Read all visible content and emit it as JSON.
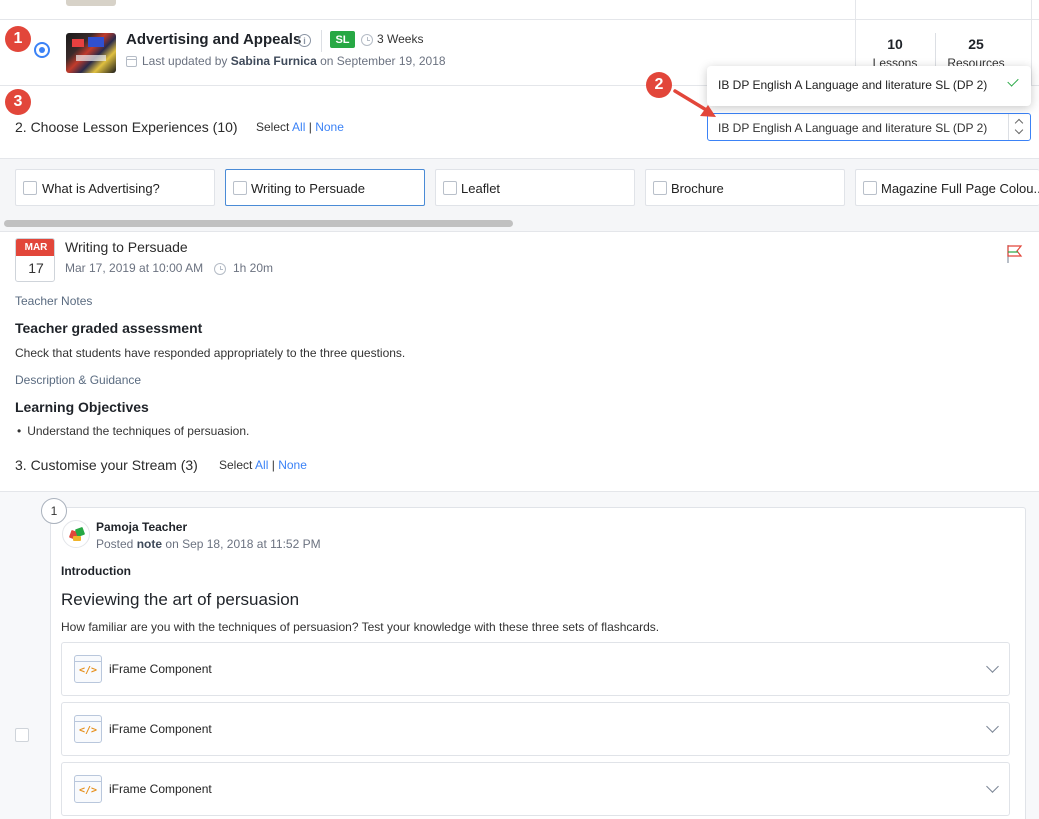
{
  "annotations": {
    "one": "1",
    "two": "2",
    "three": "3"
  },
  "unit": {
    "title": "Advertising and Appeals",
    "level_badge": "SL",
    "duration": "3 Weeks",
    "updated_prefix": "Last updated by",
    "updated_by": "Sabina Furnica",
    "updated_on": "on September 19, 2018",
    "lessons_count": "10",
    "lessons_label": "Lessons",
    "resources_count": "25",
    "resources_label": "Resources"
  },
  "lesson_experiences": {
    "title": "2. Choose Lesson Experiences (10)",
    "select_label": "Select",
    "all_label": "All",
    "separator": "|",
    "none_label": "None",
    "course_select_value": "IB DP English A Language and literature SL (DP 2)",
    "dropdown_option": "IB DP English A Language and literature SL (DP 2)",
    "cards": [
      {
        "label": "What is Advertising?"
      },
      {
        "label": "Writing to Persuade"
      },
      {
        "label": "Leaflet"
      },
      {
        "label": "Brochure"
      },
      {
        "label": "Magazine Full Page Colou..."
      }
    ]
  },
  "lesson": {
    "month": "MAR",
    "day": "17",
    "title": "Writing to Persuade",
    "datetime": "Mar 17, 2019 at 10:00 AM",
    "duration": "1h 20m",
    "teacher_notes_label": "Teacher Notes",
    "assessment_title": "Teacher graded assessment",
    "assessment_text": "Check that students have responded appropriately to the three questions.",
    "description_label": "Description & Guidance",
    "objectives_title": "Learning Objectives",
    "objective_1": "Understand the techniques of persuasion."
  },
  "stream": {
    "title": "3. Customise your Stream (3)",
    "select_label": "Select",
    "all_label": "All",
    "separator": "|",
    "none_label": "None",
    "step": "1",
    "poster": "Pamoja Teacher",
    "posted_prefix": "Posted",
    "posted_type": "note",
    "posted_on": "on Sep 18, 2018 at 11:52 PM",
    "section_label": "Introduction",
    "card_title": "Reviewing the art of persuasion",
    "card_desc": "How familiar are you with the techniques of persuasion? Test your knowledge with these three sets of flashcards.",
    "components": [
      {
        "label": "iFrame Component"
      },
      {
        "label": "iFrame Component"
      },
      {
        "label": "iFrame Component"
      }
    ]
  }
}
